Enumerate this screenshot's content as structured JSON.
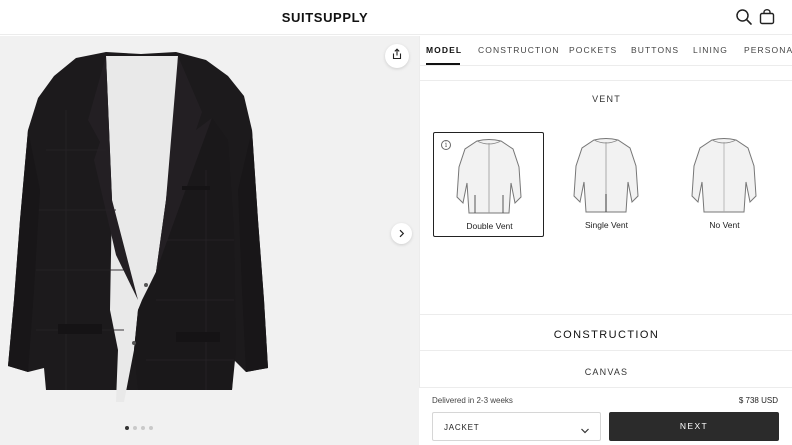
{
  "header": {
    "brand": "SUITSUPPLY",
    "icons": [
      "search-icon",
      "shopping-bag-icon"
    ]
  },
  "stage": {
    "share_icon": "share-icon",
    "next_icon": "chevron-right-icon",
    "image_count": 4,
    "active_image": 1,
    "jacket_color": "#1c1a1c"
  },
  "tabs": [
    {
      "label": "MODEL",
      "active": true
    },
    {
      "label": "CONSTRUCTION",
      "active": false
    },
    {
      "label": "POCKETS",
      "active": false
    },
    {
      "label": "BUTTONS",
      "active": false
    },
    {
      "label": "LINING",
      "active": false
    },
    {
      "label": "PERSONAL",
      "active": false
    }
  ],
  "vent": {
    "label": "VENT",
    "options": [
      {
        "label": "Double Vent",
        "selected": true,
        "info_icon": "info-icon"
      },
      {
        "label": "Single Vent",
        "selected": false
      },
      {
        "label": "No Vent",
        "selected": false
      }
    ]
  },
  "construction": {
    "title": "CONSTRUCTION",
    "sub_label": "CANVAS"
  },
  "footer": {
    "delivery": "Delivered in 2-3 weeks",
    "price": "$ 738 USD",
    "select_value": "JACKET",
    "next_label": "NEXT"
  },
  "colors": {
    "accent": "#2b2b2b",
    "stage_bg": "#f1f1f1"
  }
}
